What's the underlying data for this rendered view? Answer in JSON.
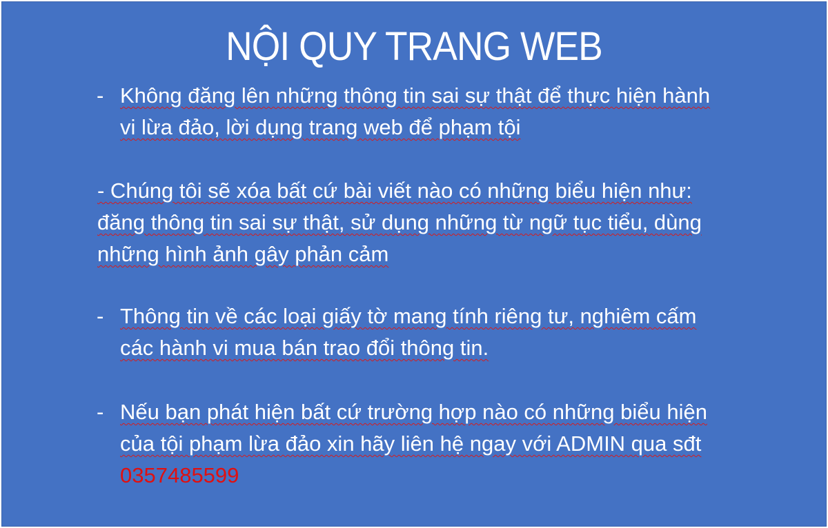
{
  "title": "NỘI QUY TRANG WEB",
  "bullet_marker": "-",
  "rules": [
    {
      "lines": [
        "Không đăng lên những thông tin sai sự thật để thực hiện hành",
        "vi lừa đảo, lời dụng trang web để phạm tội"
      ]
    },
    {
      "lines": [
        "- Chúng tôi sẽ xóa bất cứ bài viết nào có những biểu hiện như:",
        "đăng thông tin sai sự thật, sử dụng những từ ngữ tục tiểu, dùng",
        "những hình ảnh gây phản cảm"
      ]
    },
    {
      "lines": [
        "Thông tin về các loại giấy tờ mang tính riêng tư, nghiêm cấm",
        "các hành vi mua bán trao đổi thông tin."
      ]
    },
    {
      "lines": [
        "Nếu bạn phát hiện bất cứ trường hợp nào có những biểu hiện",
        "của tội phạm lừa đảo xin hãy liên hệ ngay với ADMIN qua sđt"
      ],
      "phone": "0357485599"
    }
  ],
  "colors": {
    "background": "#4472c4",
    "text": "#ffffff",
    "phone": "#e01010",
    "spellcheck_underline": "#d81b1b"
  }
}
